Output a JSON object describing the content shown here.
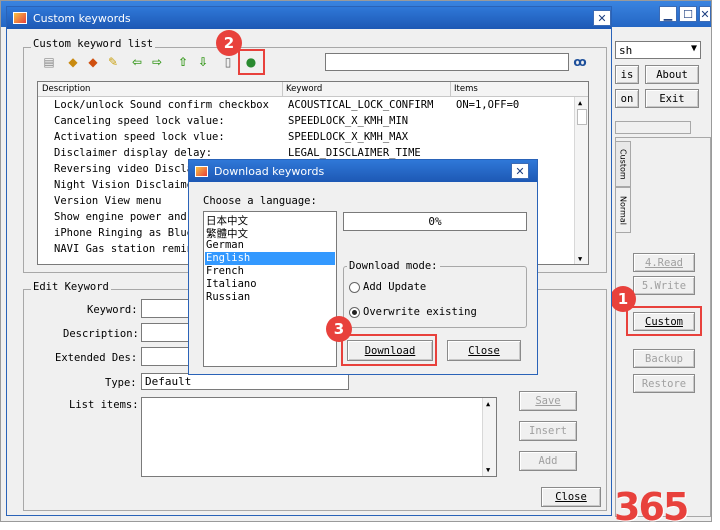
{
  "background_window": {
    "language_value": "sh",
    "buttons": {
      "is": "is",
      "about": "About",
      "on": "on",
      "exit": "Exit",
      "read": "4.Read",
      "write": "5.Write",
      "custom": "Custom",
      "backup": "Backup",
      "restore": "Restore"
    },
    "side_tabs": {
      "custom": "Custom",
      "normal": "Normal"
    }
  },
  "custom_window": {
    "title": "Custom keywords",
    "list_group_label": "Custom keyword list",
    "table": {
      "headers": [
        "Description",
        "Keyword",
        "Items"
      ],
      "rows": [
        {
          "desc": "Lock/unlock Sound confirm checkbox",
          "kw": "ACOUSTICAL_LOCK_CONFIRM",
          "items": "ON=1,OFF=0"
        },
        {
          "desc": "Canceling speed lock value:",
          "kw": "SPEEDLOCK_X_KMH_MIN",
          "items": ""
        },
        {
          "desc": "Activation speed lock vlue:",
          "kw": "SPEEDLOCK_X_KMH_MAX",
          "items": ""
        },
        {
          "desc": "Disclaimer display delay:",
          "kw": "LEGAL_DISCLAIMER_TIME",
          "items": ""
        },
        {
          "desc": "Reversing video Discla",
          "kw": "",
          "items": ""
        },
        {
          "desc": "Night Vision Disclaime",
          "kw": "",
          "items": ""
        },
        {
          "desc": "Version View menu",
          "kw": "",
          "items": ""
        },
        {
          "desc": "Show engine power and",
          "kw": "",
          "items": ""
        },
        {
          "desc": "iPhone Ringing as Blue",
          "kw": "",
          "items": ""
        },
        {
          "desc": "NAVI Gas station remin",
          "kw": "",
          "items": ""
        }
      ]
    },
    "edit_group_label": "Edit Keyword",
    "edit_labels": {
      "keyword": "Keyword:",
      "description": "Description:",
      "extended": "Extended Des:",
      "type": "Type:",
      "list_items": "List items:"
    },
    "type_value": "Default",
    "buttons": {
      "save": "Save",
      "insert": "Insert",
      "add": "Add",
      "close": "Close"
    }
  },
  "download_dialog": {
    "title": "Download keywords",
    "choose_label": "Choose a language:",
    "languages": [
      "日本中文",
      "繁體中文",
      "German",
      "English",
      "French",
      "Italiano",
      "Russian"
    ],
    "selected_index": 3,
    "progress_text": "0%",
    "progress_fraction": 0,
    "mode_label": "Download mode:",
    "modes": [
      "Add Update",
      "Overwrite existing"
    ],
    "selected_mode": 1,
    "download_label": "Download",
    "close_label": "Close"
  },
  "callouts": [
    "1",
    "2",
    "3"
  ],
  "watermark": "365",
  "colors": {
    "accent": "#2f78d8",
    "callout": "#e8413c",
    "selection": "#3399ff"
  }
}
